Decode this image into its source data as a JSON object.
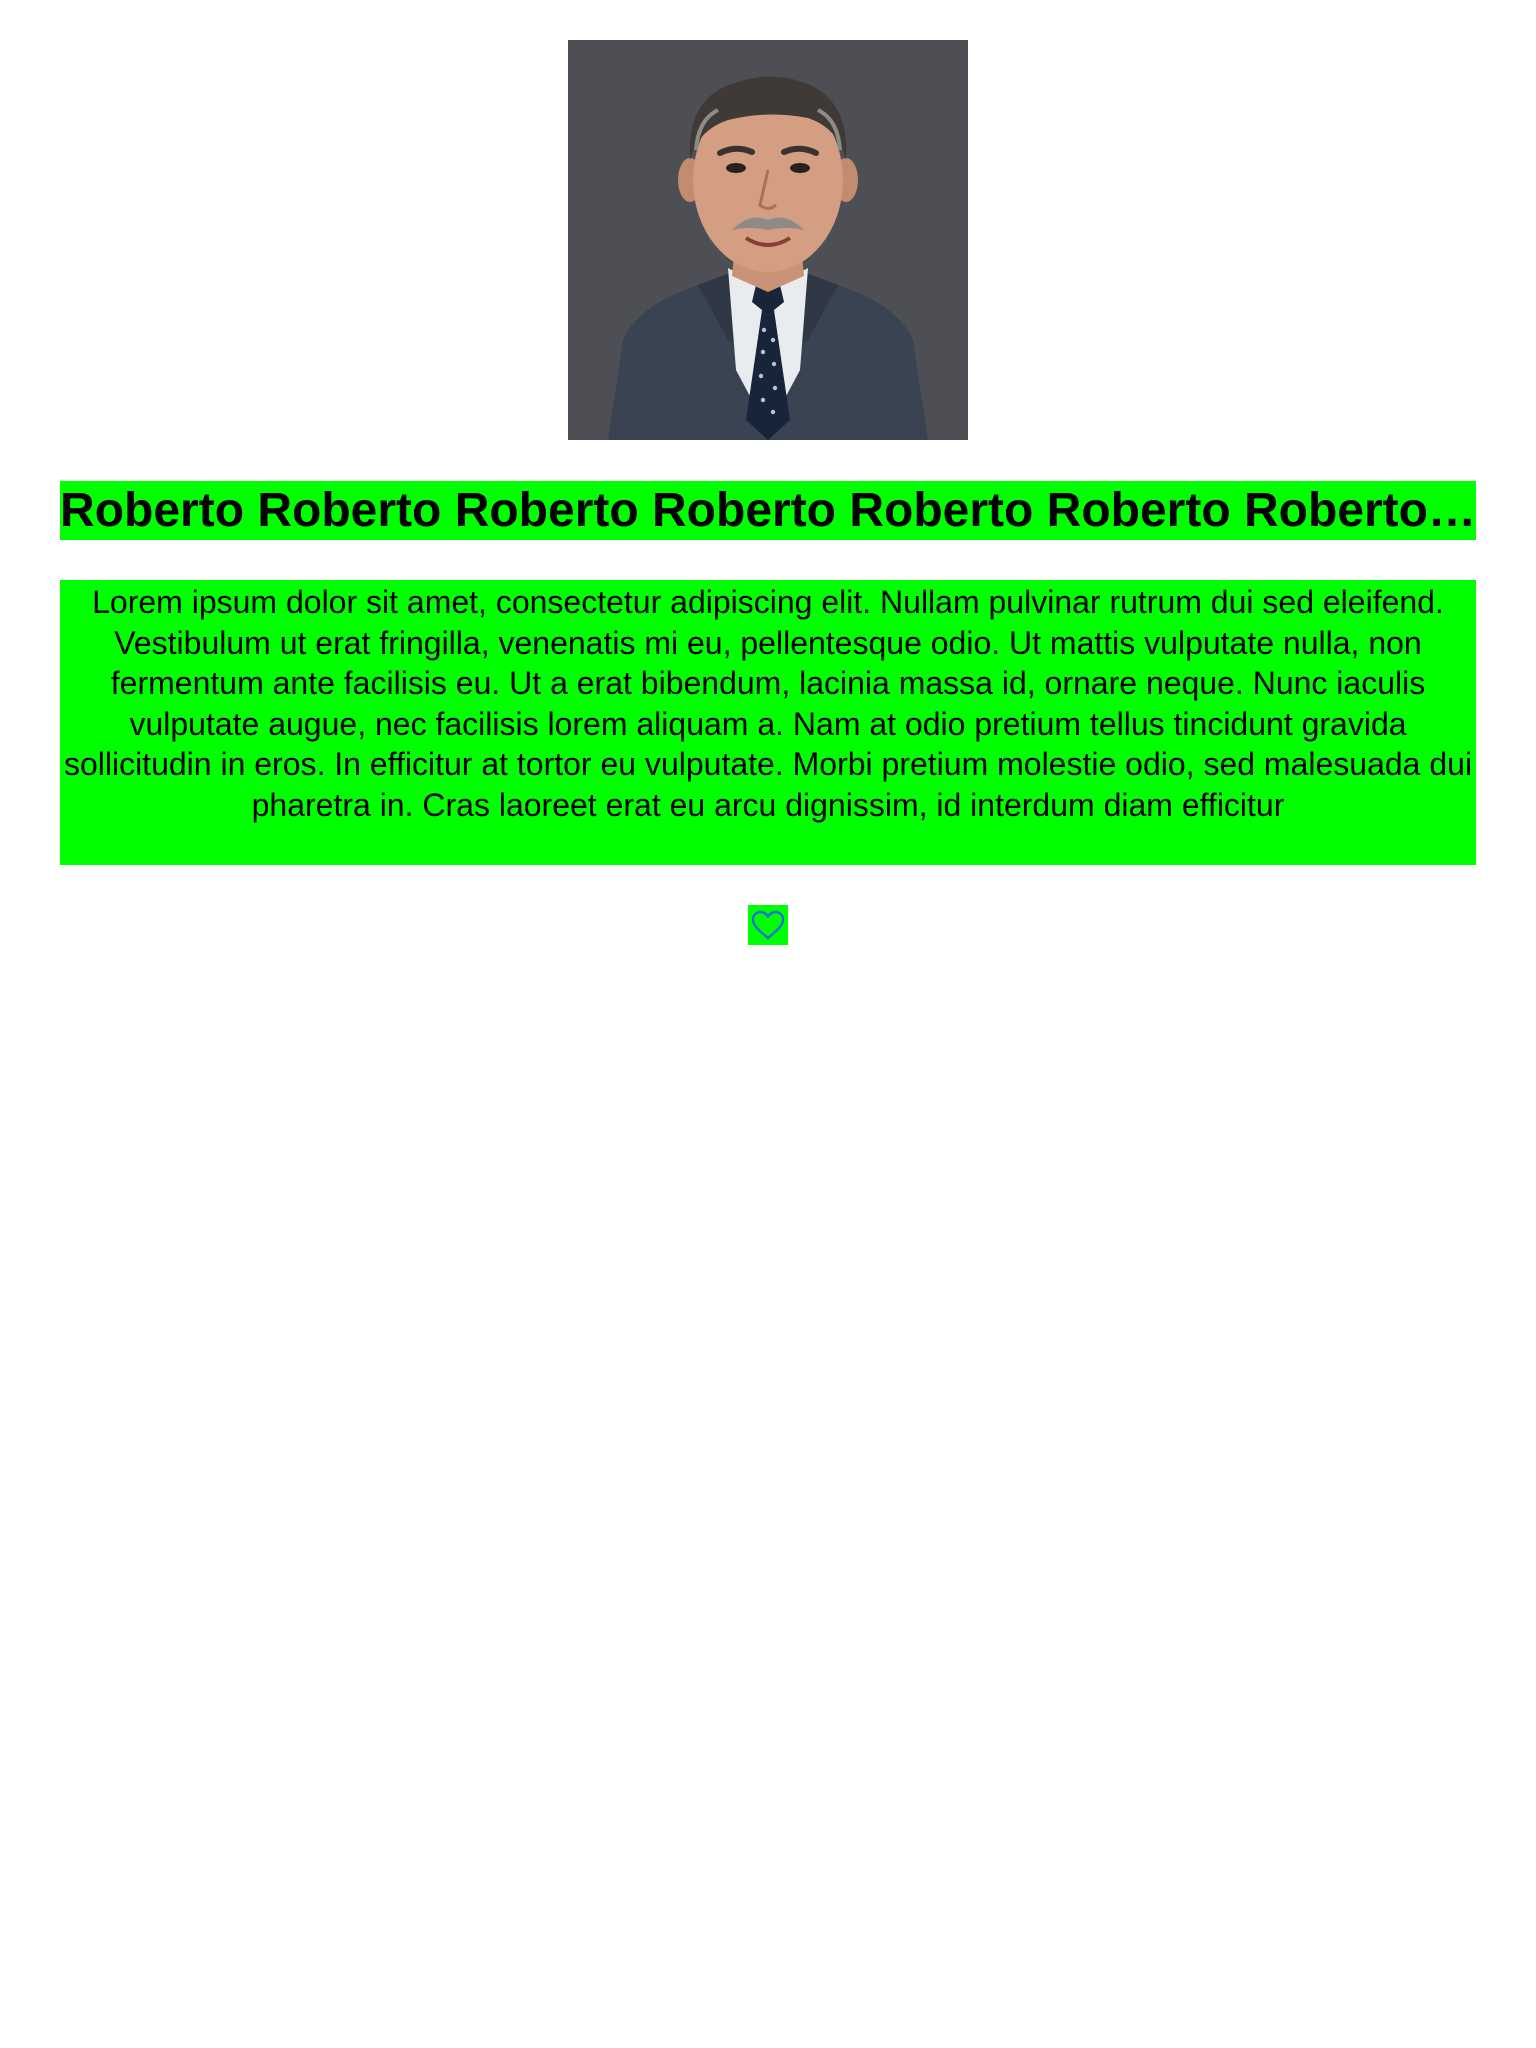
{
  "profile": {
    "name": "Roberto Roberto Roberto Roberto Roberto Roberto Roberto…",
    "bio": "Lorem ipsum dolor sit amet, consectetur adipiscing elit. Nullam pulvinar rutrum dui sed eleifend. Vestibulum ut erat fringilla, venenatis mi eu, pellentesque odio. Ut mattis vulputate nulla, non fermentum ante facilisis eu. Ut a erat bibendum, lacinia massa id, ornare neque. Nunc iaculis vulputate augue, nec facilisis lorem aliquam a. Nam at odio pretium tellus tincidunt gravida sollicitudin in eros. In efficitur at tortor eu vulputate. Morbi pretium molestie odio, sed malesuada dui pharetra in. Cras laoreet erat eu arcu dignissim, id interdum diam efficitur",
    "favorite_icon": "heart-outline-icon"
  },
  "colors": {
    "highlight": "#00ff00",
    "heart_stroke": "#1e6fd9",
    "page_background": "#ffffff",
    "text": "#000000"
  }
}
